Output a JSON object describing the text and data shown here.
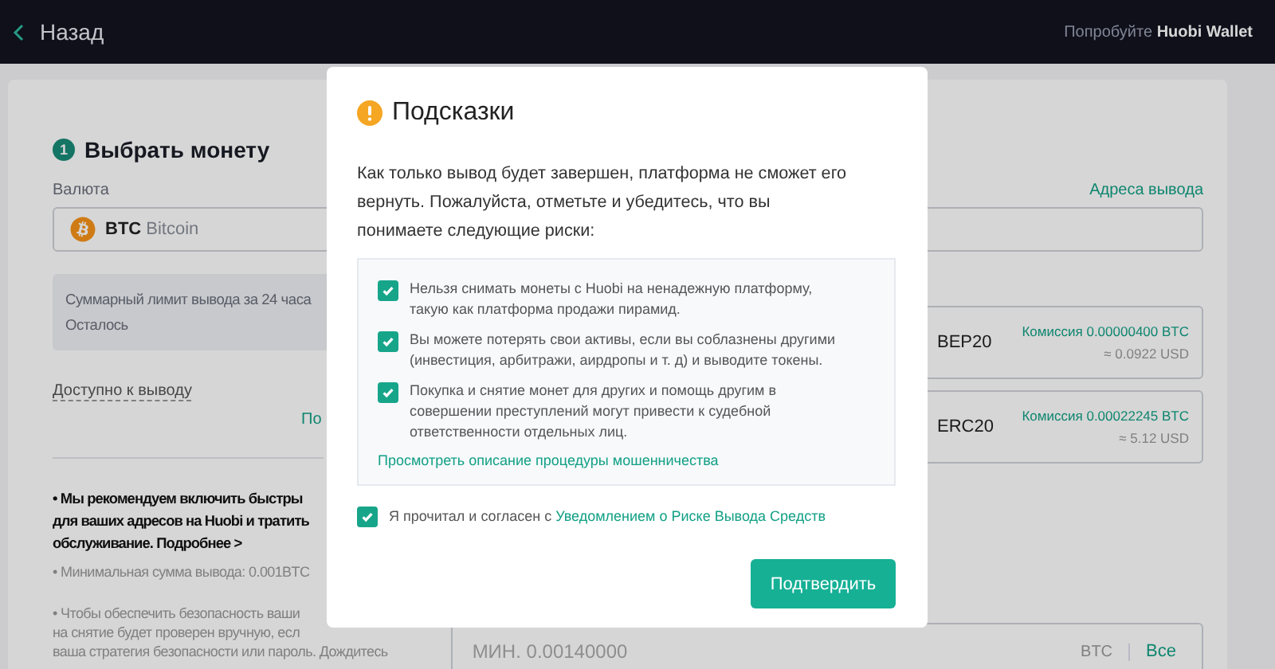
{
  "header": {
    "back_label": "Назад",
    "promo": "Попробуйте **Huobi Wallet**"
  },
  "form": {
    "step_number": "1",
    "step_title": "Выбрать монету",
    "currency_label": "Валюта",
    "addresses_link": "Адреса вывода",
    "coin": {
      "symbol": "BTC",
      "name": "Bitcoin"
    },
    "limit_lines": [
      "Суммарный лимит вывода за 24 часа",
      "Осталось"
    ],
    "available_label": "Доступно к выводу",
    "cut_text": "По",
    "networks": [
      {
        "name": "BEP20",
        "fee": "Комиссия 0.00000400 BTC",
        "fee_usd": "≈ 0.0922 USD"
      },
      {
        "name": "ERC20",
        "fee": "Комиссия 0.00022245 BTC",
        "fee_usd": "≈ 5.12 USD"
      }
    ],
    "recommendation_lines": [
      "• Мы рекомендуем включить быстры",
      "для ваших адресов на Huobi и тратить",
      "обслуживание. Подробнее >"
    ],
    "min_note": "• Минимальная сумма вывода: 0.001BTC",
    "security_lines": [
      "• Чтобы обеспечить безопасность ваши",
      "на снятие будет проверен вручную, есл",
      "ваша стратегия безопасности или пароль. Дождитесь"
    ],
    "amount_field": {
      "placeholder": "МИН. 0.00140000",
      "unit": "BTC",
      "max_button": "Все"
    }
  },
  "dialog": {
    "title": "Подсказки",
    "message": "Как только вывод будет завершен, платформа не сможет его вернуть. Пожалуйста, отметьте и убедитесь, что вы понимаете следующие риски:",
    "risks": [
      {
        "text": "Нельзя снимать монеты с Huobi на ненадежную платформу, такую как платформа продажи пирамид.",
        "checked": true
      },
      {
        "text": "Вы можете потерять свои активы, если вы соблазнены другими (инвестиция, арбитражи, аирдропы и т. д) и выводите токены.",
        "checked": true
      },
      {
        "text": "Покупка и снятие монет для других и помощь другим в совершении преступлений могут привести к судебной ответственности отдельных лиц.",
        "checked": true
      }
    ],
    "fraud_link": "Просмотреть описание процедуры мошенничества",
    "agreement": {
      "checked": true,
      "text": "Я прочитал и согласен с",
      "link": "Уведомлением о Риске Вывода Средств"
    },
    "confirm_button": "Подтвердить"
  }
}
